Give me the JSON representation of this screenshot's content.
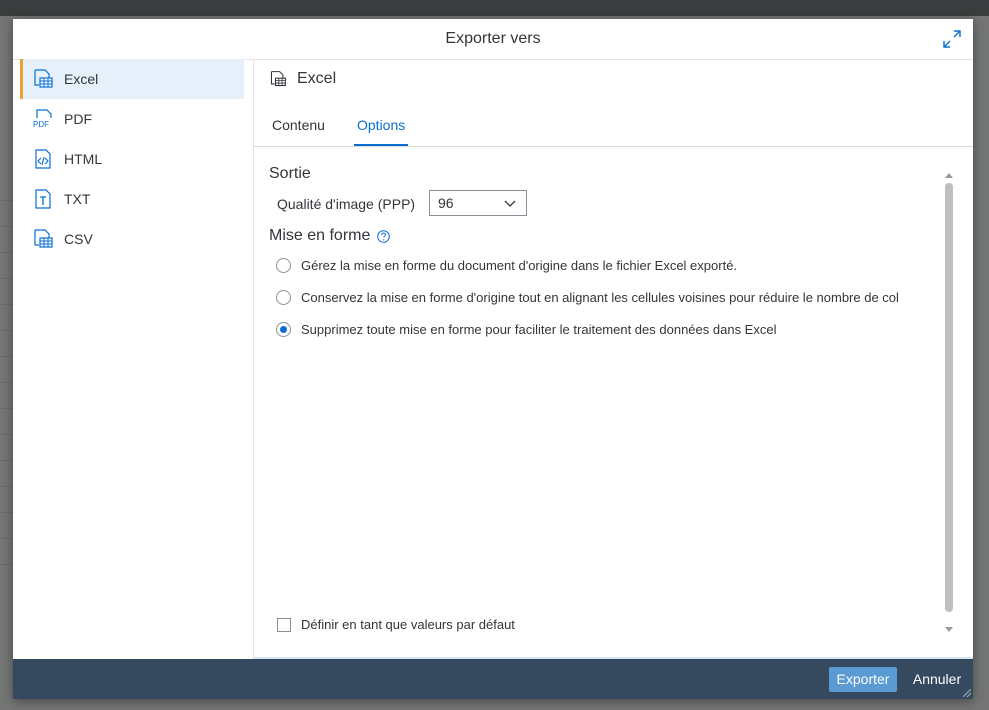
{
  "dialog": {
    "title": "Exporter vers"
  },
  "sidebar": {
    "items": [
      {
        "label": "Excel",
        "icon": "excel-table-icon",
        "active": true
      },
      {
        "label": "PDF",
        "icon": "pdf-icon",
        "active": false
      },
      {
        "label": "HTML",
        "icon": "html-code-icon",
        "active": false
      },
      {
        "label": "TXT",
        "icon": "txt-icon",
        "active": false
      },
      {
        "label": "CSV",
        "icon": "csv-table-icon",
        "active": false
      }
    ]
  },
  "content": {
    "title": "Excel",
    "tabs": [
      {
        "label": "Contenu",
        "selected": false
      },
      {
        "label": "Options",
        "selected": true
      }
    ],
    "options": {
      "output_section": "Sortie",
      "image_quality_label": "Qualité d'image (PPP)",
      "image_quality_value": "96",
      "format_section": "Mise en forme",
      "radios": [
        {
          "label": "Gérez la mise en forme du document d'origine dans le fichier Excel exporté.",
          "checked": false
        },
        {
          "label": "Conservez la mise en forme d'origine tout en alignant les cellules voisines pour réduire le nombre de col",
          "checked": false
        },
        {
          "label": "Supprimez toute mise en forme pour faciliter le traitement des données dans Excel",
          "checked": true
        }
      ],
      "default_checkbox_label": "Définir en tant que valeurs par défaut",
      "default_checkbox_checked": false
    }
  },
  "footer": {
    "export_label": "Exporter",
    "cancel_label": "Annuler"
  },
  "colors": {
    "accent": "#0a6ed1",
    "selected_marker": "#e9a22c",
    "footer_bg": "#354a5f",
    "primary_button": "#5a9bd4"
  }
}
